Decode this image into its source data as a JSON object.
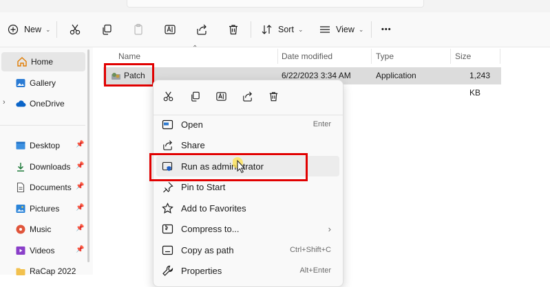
{
  "toolbar": {
    "new_label": "New",
    "sort_label": "Sort",
    "view_label": "View",
    "more_label": "•••"
  },
  "sidebar": {
    "items": [
      {
        "label": "Home",
        "icon": "home-icon"
      },
      {
        "label": "Gallery",
        "icon": "gallery-icon"
      },
      {
        "label": "OneDrive",
        "icon": "cloud-icon"
      },
      {
        "label": "Desktop",
        "icon": "desktop-icon",
        "pinned": true
      },
      {
        "label": "Downloads",
        "icon": "download-icon",
        "pinned": true
      },
      {
        "label": "Documents",
        "icon": "documents-icon",
        "pinned": true
      },
      {
        "label": "Pictures",
        "icon": "pictures-icon",
        "pinned": true
      },
      {
        "label": "Music",
        "icon": "music-icon",
        "pinned": true
      },
      {
        "label": "Videos",
        "icon": "videos-icon",
        "pinned": true
      },
      {
        "label": "RaCap 2022",
        "icon": "folder-icon"
      }
    ]
  },
  "columns": {
    "name": "Name",
    "date": "Date modified",
    "type": "Type",
    "size": "Size"
  },
  "file": {
    "name": "Patch",
    "date": "6/22/2023 3:34 AM",
    "type": "Application",
    "size": "1,243 KB"
  },
  "menu": {
    "quick_actions": [
      "cut-icon",
      "copy-icon",
      "rename-icon",
      "share-icon",
      "delete-icon"
    ],
    "items": [
      {
        "label": "Open",
        "shortcut": "Enter",
        "icon": "open-icon"
      },
      {
        "label": "Share",
        "shortcut": "",
        "icon": "share-icon"
      },
      {
        "label": "Run as administrator",
        "shortcut": "",
        "icon": "shield-icon"
      },
      {
        "label": "Pin to Start",
        "shortcut": "",
        "icon": "pin-icon"
      },
      {
        "label": "Add to Favorites",
        "shortcut": "",
        "icon": "star-icon"
      },
      {
        "label": "Compress to...",
        "shortcut": "",
        "icon": "archive-icon"
      },
      {
        "label": "Copy as path",
        "shortcut": "Ctrl+Shift+C",
        "icon": "path-icon"
      },
      {
        "label": "Properties",
        "shortcut": "Alt+Enter",
        "icon": "wrench-icon"
      }
    ]
  },
  "colors": {
    "highlight": "#e10000",
    "accent": "#0067c0"
  }
}
